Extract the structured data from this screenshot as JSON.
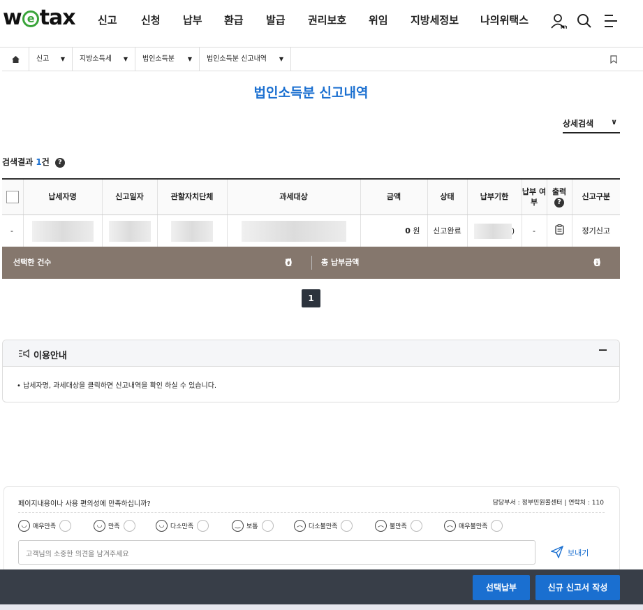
{
  "header": {
    "logo": "wetax",
    "nav": [
      "신고",
      "신청",
      "납부",
      "환급",
      "발급",
      "권리보호",
      "위임",
      "지방세정보",
      "나의위택스"
    ],
    "icons": [
      "my-user-icon",
      "search-icon",
      "menu-icon"
    ]
  },
  "breadcrumb": [
    "신고",
    "지방소득세",
    "법인소득분",
    "법인소득분 신고내역"
  ],
  "page_title": "법인소득분 신고내역",
  "detail_search": "상세검색",
  "results": {
    "label": "검색결과",
    "count": "1",
    "unit": "건"
  },
  "table": {
    "headers": [
      "",
      "납세자명",
      "신고일자",
      "관할자치단체",
      "과세대상",
      "금액",
      "상태",
      "납부기한",
      "납부 여부",
      "출력",
      "신고구분"
    ],
    "row": {
      "no": "-",
      "amount": "0",
      "amount_unit": "원",
      "status": "신고완료",
      "deadline_tail": ")",
      "paid": "-",
      "type": "정기신고"
    }
  },
  "summary": {
    "selected_label": "선택한 건수",
    "selected_count": "0",
    "count_unit": "건",
    "total_label": "총 납부금액",
    "total_amount": "0",
    "amount_unit": "원"
  },
  "pagination": {
    "current": "1"
  },
  "guide": {
    "title": "이용안내",
    "text": "• 납세자명, 과세대상을 클릭하면 신고내역을 확인 하실 수 있습니다."
  },
  "feedback": {
    "question": "페이지내용이나 사용 편의성에 만족하십니까?",
    "contact": "담당부서 : 정부민원콜센터  |  연락처 : 110",
    "options": [
      "매우만족",
      "만족",
      "다소만족",
      "보통",
      "다소불만족",
      "불만족",
      "매우불만족"
    ],
    "placeholder": "고객님의 소중한 의견을 남겨주세요",
    "send": "보내기"
  },
  "actions": {
    "pay": "선택납부",
    "new_report": "신규 신고서 작성"
  }
}
